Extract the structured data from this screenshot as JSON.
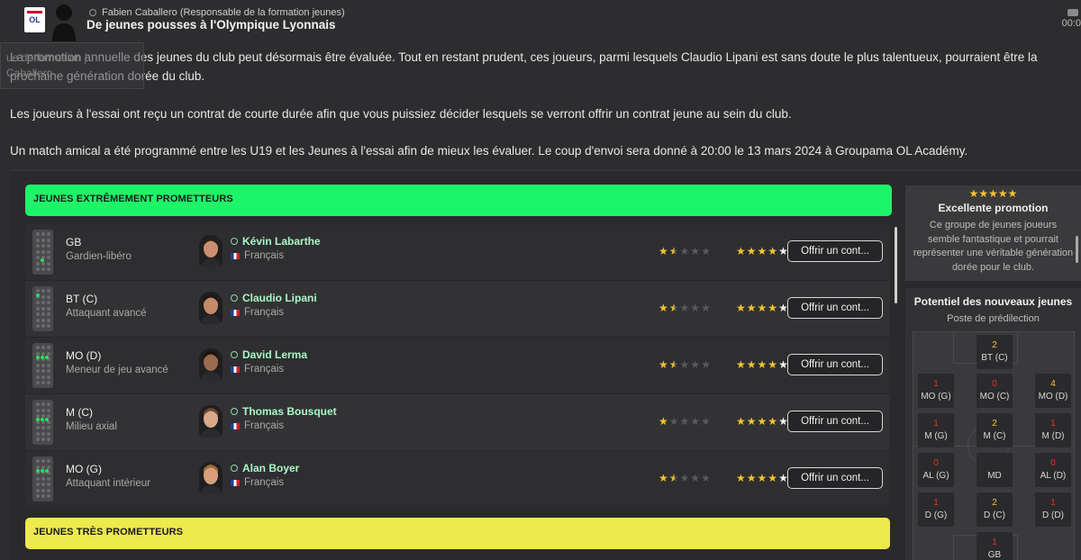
{
  "header": {
    "club_logo_text": "OL",
    "sender": "Fabien Caballero  (Responsable de la formation jeunes)",
    "subject": "De jeunes pousses à l'Olympique Lyonnais",
    "time": "00:0"
  },
  "ghost_text": "ue de formation j\nCaballero",
  "paragraphs": [
    "La promotion annuelle des jeunes du club peut désormais être évaluée. Tout en restant prudent, ces joueurs, parmi lesquels Claudio Lipani est sans doute le plus talentueux, pourraient être la prochaine génération dorée du club.",
    "Les joueurs à l'essai ont reçu un contrat de courte durée afin que vous puissiez décider lesquels se verront offrir un contrat jeune au sein du club.",
    "Un match amical a été programmé entre les U19 et les Jeunes à l'essai afin de mieux les évaluer. Le coup d'envoi sera donné à 20:00 le 13 mars 2024 à Groupama OL Académy."
  ],
  "groups": {
    "very_high": "JEUNES EXTRÊMEMENT PROMETTEURS",
    "high": "JEUNES TRÈS PROMETTEURS"
  },
  "offer_label": "Offrir un cont...",
  "players": [
    {
      "position": "GB",
      "role": "Gardien-libéro",
      "name": "Kévin Labarthe",
      "nationality": "Français",
      "current_stars": 1.5,
      "potential_stars": 5
    },
    {
      "position": "BT (C)",
      "role": "Attaquant avancé",
      "name": "Claudio Lipani",
      "nationality": "Français",
      "current_stars": 1.5,
      "potential_stars": 5
    },
    {
      "position": "MO (D)",
      "role": "Meneur de jeu avancé",
      "name": "David Lerma",
      "nationality": "Français",
      "current_stars": 1.5,
      "potential_stars": 5
    },
    {
      "position": "M (C)",
      "role": "Milieu axial",
      "name": "Thomas Bousquet",
      "nationality": "Français",
      "current_stars": 1,
      "potential_stars": 5
    },
    {
      "position": "MO (G)",
      "role": "Attaquant intérieur",
      "name": "Alan Boyer",
      "nationality": "Français",
      "current_stars": 1.5,
      "potential_stars": 5
    }
  ],
  "promotion": {
    "stars": "★★★★★",
    "title": "Excellente promotion",
    "text": "Ce groupe de jeunes joueurs semble fantastique et pourrait représenter une véritable génération dorée pour le club."
  },
  "potential": {
    "title": "Potentiel des nouveaux jeunes",
    "subtitle": "Poste de prédilection",
    "cells": [
      {
        "label": "BT (C)",
        "count": "2"
      },
      {
        "label": "MO (G)",
        "count": "1"
      },
      {
        "label": "MO (C)",
        "count": "0"
      },
      {
        "label": "MO (D)",
        "count": "4"
      },
      {
        "label": "M (G)",
        "count": "1"
      },
      {
        "label": "M (C)",
        "count": "2"
      },
      {
        "label": "M (D)",
        "count": "1"
      },
      {
        "label": "AL (G)",
        "count": "0"
      },
      {
        "label": "MD",
        "count": ""
      },
      {
        "label": "AL (D)",
        "count": "0"
      },
      {
        "label": "D (G)",
        "count": "1"
      },
      {
        "label": "D (C)",
        "count": "2"
      },
      {
        "label": "D (D)",
        "count": "1"
      },
      {
        "label": "GB",
        "count": "1"
      }
    ]
  }
}
